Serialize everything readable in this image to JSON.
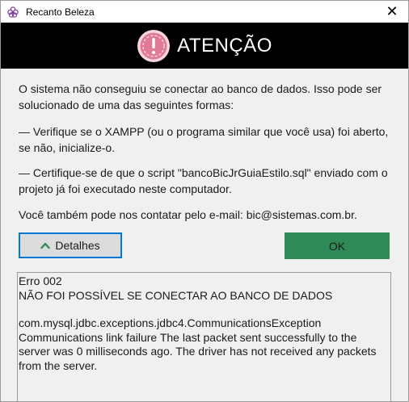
{
  "window": {
    "title": "Recanto Beleza",
    "close_glyph": "✕"
  },
  "banner": {
    "title": "ATENÇÃO",
    "icon": "warning-badge-icon"
  },
  "message": {
    "line1": "O sistema não conseguiu se conectar ao banco de dados. Isso pode ser solucionado de uma das seguintes formas:",
    "line2": "— Verifique se o XAMPP (ou o programa similar que você usa) foi aberto, se não, inicialize-o.",
    "line3": "— Certifique-se de que o script \"bancoBicJrGuiaEstilo.sql\" enviado com o projeto já foi executado neste computador.",
    "line4": "Você também pode nos contatar pelo e-mail: bic@sistemas.com.br."
  },
  "buttons": {
    "details_label": "Detalhes",
    "ok_label": "OK"
  },
  "details": {
    "code": "Erro 002",
    "summary": "NÃO FOI POSSÍVEL SE CONECTAR AO BANCO DE DADOS",
    "exception": "com.mysql.jdbc.exceptions.jdbc4.CommunicationsException",
    "line_a": "Communications link failure The last packet sent successfully to the",
    "line_b": "server was 0 milliseconds ago. The driver has not received any packets",
    "line_c": "from the server."
  },
  "colors": {
    "banner_bg": "#000000",
    "ok_bg": "#2e8b57",
    "focus_border": "#0078d7",
    "icon_pink": "#e07a95"
  }
}
